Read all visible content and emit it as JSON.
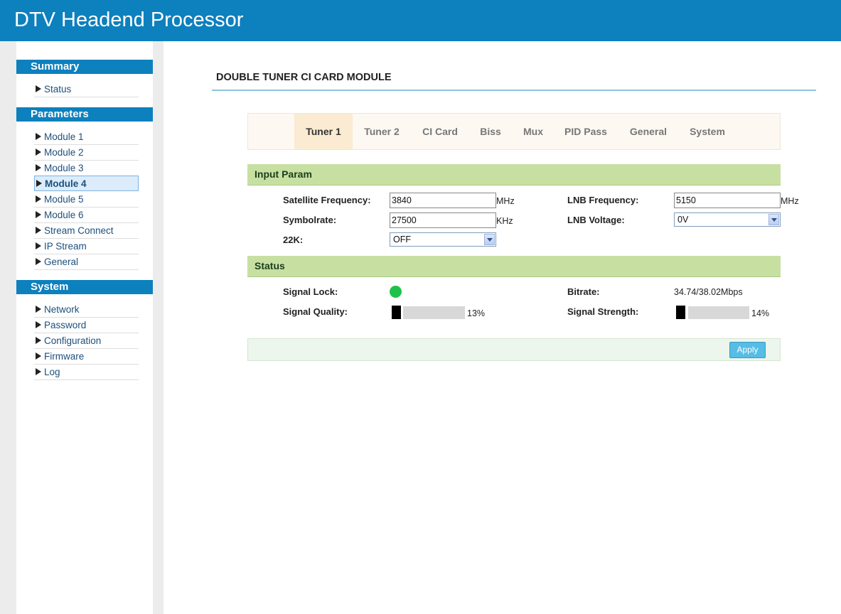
{
  "header": {
    "title": "DTV Headend Processor"
  },
  "sidebar": {
    "sections": [
      {
        "title": "Summary",
        "items": [
          "Status"
        ]
      },
      {
        "title": "Parameters",
        "items": [
          "Module 1",
          "Module 2",
          "Module 3",
          "Module 4",
          "Module 5",
          "Module 6",
          "Stream Connect",
          "IP Stream",
          "General"
        ]
      },
      {
        "title": "System",
        "items": [
          "Network",
          "Password",
          "Configuration",
          "Firmware",
          "Log"
        ]
      }
    ],
    "active_item": "Module 4"
  },
  "main": {
    "page_title": "DOUBLE TUNER CI CARD MODULE",
    "tabs": [
      "Tuner 1",
      "Tuner 2",
      "CI Card",
      "Biss",
      "Mux",
      "PID Pass",
      "General",
      "System"
    ],
    "active_tab": "Tuner 1",
    "input_param": {
      "section_title": "Input Param",
      "satellite_frequency": {
        "label": "Satellite Frequency:",
        "value": "3840",
        "unit": "MHz"
      },
      "lnb_frequency": {
        "label": "LNB Frequency:",
        "value": "5150",
        "unit": "MHz"
      },
      "symbolrate": {
        "label": "Symbolrate:",
        "value": "27500",
        "unit": "KHz"
      },
      "lnb_voltage": {
        "label": "LNB Voltage:",
        "value": "0V"
      },
      "k22": {
        "label": "22K:",
        "value": "OFF"
      }
    },
    "status": {
      "section_title": "Status",
      "signal_lock": {
        "label": "Signal Lock:",
        "color": "#1ec24a"
      },
      "bitrate": {
        "label": "Bitrate:",
        "value": "34.74/38.02Mbps"
      },
      "signal_quality": {
        "label": "Signal Quality:",
        "percent_text": "13%",
        "percent": 13
      },
      "signal_strength": {
        "label": "Signal Strength:",
        "percent_text": "14%",
        "percent": 14
      }
    },
    "apply_label": "Apply"
  },
  "colors": {
    "header": "#0d80be",
    "section_bar": "#c7e0a2",
    "active_tab": "#faebd2",
    "apply": "#55bde6"
  }
}
